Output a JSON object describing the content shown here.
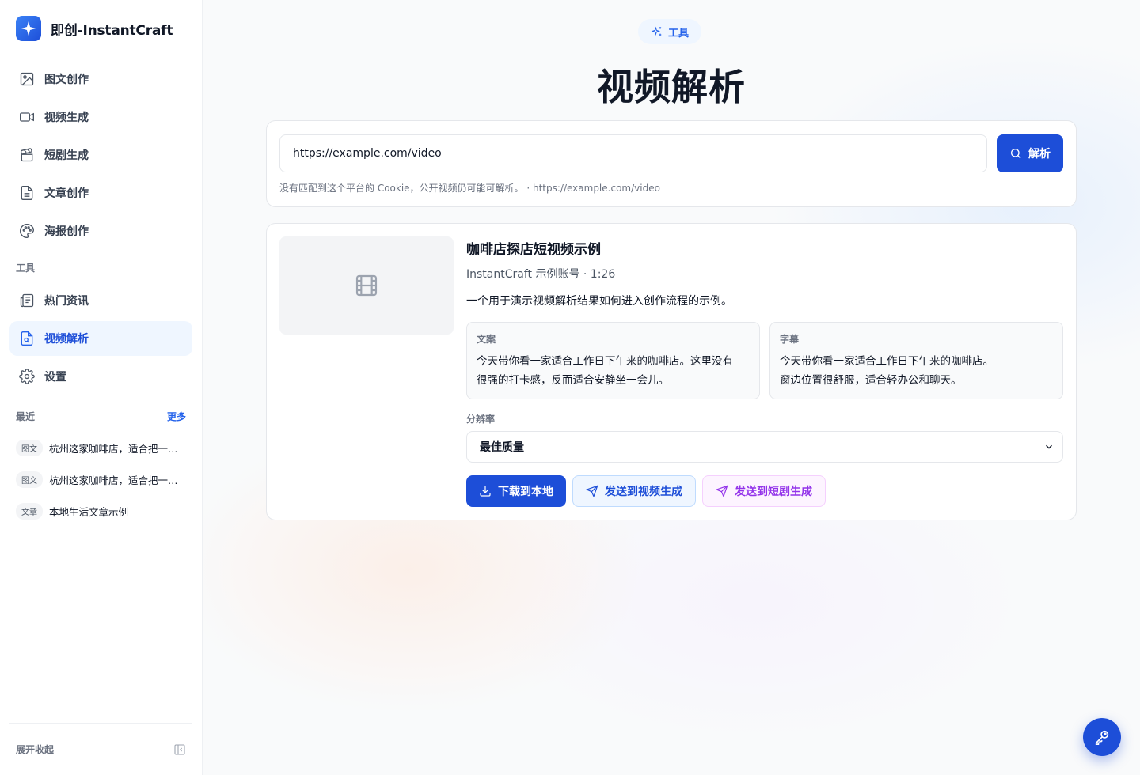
{
  "brand": {
    "name": "即创-InstantCraft"
  },
  "nav": {
    "items": [
      {
        "label": "图文创作",
        "icon": "image-icon"
      },
      {
        "label": "视频生成",
        "icon": "video-icon"
      },
      {
        "label": "短剧生成",
        "icon": "clapperboard-icon"
      },
      {
        "label": "文章创作",
        "icon": "document-icon"
      },
      {
        "label": "海报创作",
        "icon": "palette-icon"
      }
    ],
    "tools_label": "工具",
    "tools": [
      {
        "label": "热门资讯",
        "icon": "newspaper-icon"
      },
      {
        "label": "视频解析",
        "icon": "file-search-icon",
        "active": true
      },
      {
        "label": "设置",
        "icon": "gear-icon"
      }
    ]
  },
  "recent": {
    "label": "最近",
    "more": "更多",
    "items": [
      {
        "tag": "图文",
        "text": "杭州这家咖啡店，适合把一个周末下午都交给它"
      },
      {
        "tag": "图文",
        "text": "杭州这家咖啡店，适合把一个周末下午都交给它"
      },
      {
        "tag": "文章",
        "text": "本地生活文章示例"
      }
    ]
  },
  "sidebar_footer": {
    "toggle_label": "展开收起"
  },
  "header": {
    "pill_label": "工具",
    "title": "视频解析"
  },
  "search": {
    "value": "https://example.com/video",
    "button_label": "解析",
    "hint": "没有匹配到这个平台的 Cookie，公开视频仍可能可解析。 · https://example.com/video"
  },
  "result": {
    "title": "咖啡店探店短视频示例",
    "meta": "InstantCraft 示例账号 · 1:26",
    "description": "一个用于演示视频解析结果如何进入创作流程的示例。",
    "copy": {
      "label": "文案",
      "text": "今天带你看一家适合工作日下午来的咖啡店。这里没有\n很强的打卡感，反而适合安静坐一会儿。"
    },
    "subtitles": {
      "label": "字幕",
      "text": "今天带你看一家适合工作日下午来的咖啡店。\n窗边位置很舒服，适合轻办公和聊天。"
    },
    "resolution_label": "分辨率",
    "resolution_value": "最佳质量",
    "actions": {
      "download": "下载到本地",
      "send_video": "发送到视频生成",
      "send_drama": "发送到短剧生成"
    }
  },
  "colors": {
    "accent": "#1d4ed8",
    "active_bg": "#eff6ff",
    "drama_accent": "#9333ea"
  }
}
